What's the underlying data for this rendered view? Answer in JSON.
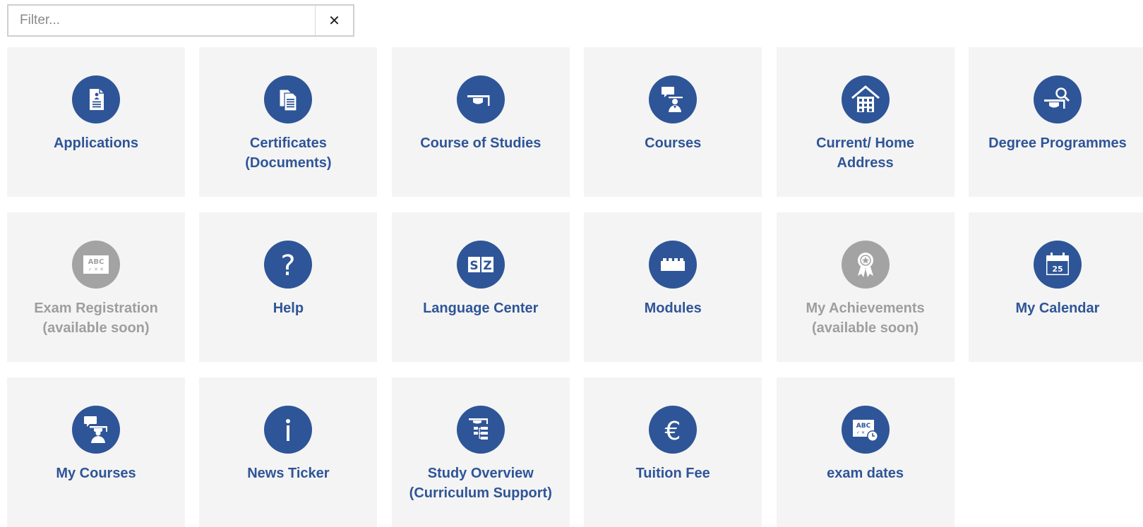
{
  "filter": {
    "placeholder": "Filter...",
    "value": "",
    "clear_label": "✕"
  },
  "tiles": [
    {
      "line1": "Applications",
      "line2": "",
      "icon": "application-document-icon",
      "enabled": true
    },
    {
      "line1": "Certificates",
      "line2": "(Documents)",
      "icon": "certificates-documents-icon",
      "enabled": true
    },
    {
      "line1": "Course of Studies",
      "line2": "",
      "icon": "mortarboard-icon",
      "enabled": true
    },
    {
      "line1": "Courses",
      "line2": "",
      "icon": "lecturer-speech-icon",
      "enabled": true
    },
    {
      "line1": "Current/ Home",
      "line2": "Address",
      "icon": "house-icon",
      "enabled": true
    },
    {
      "line1": "Degree Programmes",
      "line2": "",
      "icon": "mortarboard-magnifier-icon",
      "enabled": true
    },
    {
      "line1": "Exam Registration",
      "line2": "(available soon)",
      "icon": "abc-exam-board-icon",
      "enabled": false
    },
    {
      "line1": "Help",
      "line2": "",
      "icon": "question-mark-icon",
      "enabled": true
    },
    {
      "line1": "Language Center",
      "line2": "",
      "icon": "language-sz-icon",
      "enabled": true
    },
    {
      "line1": "Modules",
      "line2": "",
      "icon": "building-block-icon",
      "enabled": true
    },
    {
      "line1": "My Achievements",
      "line2": "(available soon)",
      "icon": "award-ribbon-icon",
      "enabled": false
    },
    {
      "line1": "My Calendar",
      "line2": "",
      "icon": "calendar-icon",
      "calendar_day": "25",
      "enabled": true
    },
    {
      "line1": "My Courses",
      "line2": "",
      "icon": "student-speech-icon",
      "enabled": true
    },
    {
      "line1": "News Ticker",
      "line2": "",
      "icon": "info-icon",
      "enabled": true
    },
    {
      "line1": "Study Overview",
      "line2": "(Curriculum Support)",
      "icon": "curriculum-tree-icon",
      "enabled": true
    },
    {
      "line1": "Tuition Fee",
      "line2": "",
      "icon": "euro-icon",
      "enabled": true
    },
    {
      "line1": "exam dates",
      "line2": "",
      "icon": "exam-dates-clock-icon",
      "enabled": true
    }
  ],
  "colors": {
    "accent": "#2e5597",
    "disabled": "#a3a3a3",
    "tile_background": "#f4f4f4"
  }
}
